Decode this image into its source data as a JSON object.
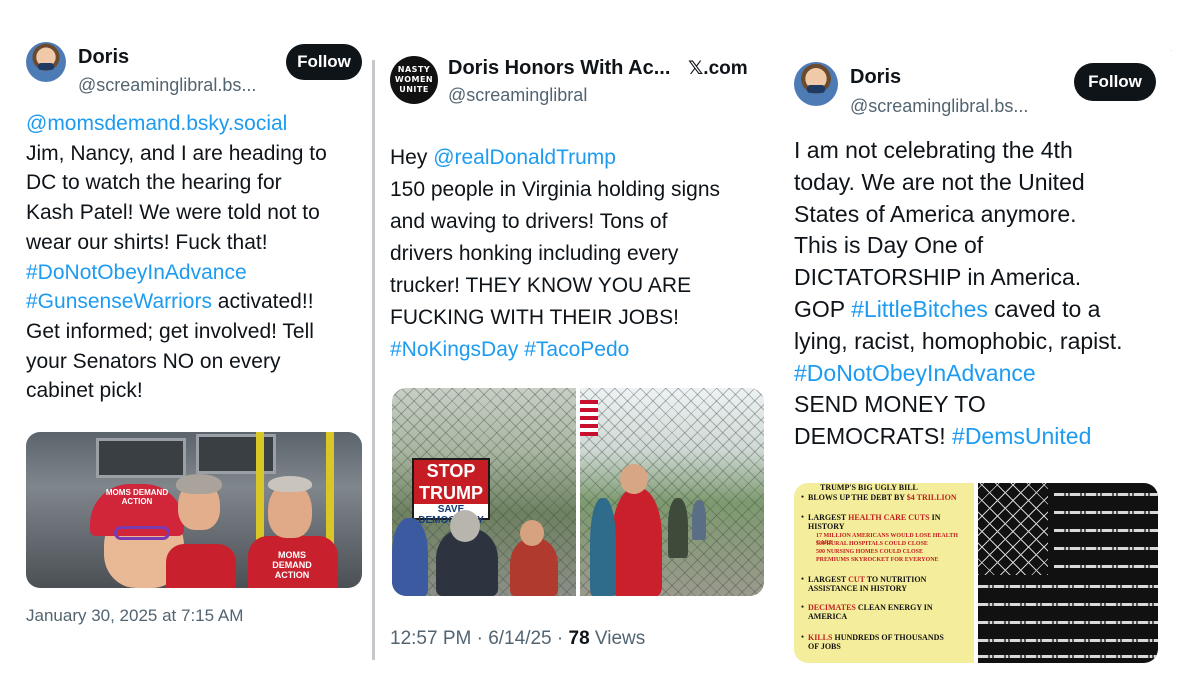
{
  "tweet1": {
    "name": "Doris",
    "handle": "@screaminglibral.bs...",
    "follow_label": "Follow",
    "lines": [
      {
        "text": "@momsdemand.bsky.social",
        "link": true
      },
      {
        "text": "Jim, Nancy, and I are heading to",
        "link": false
      },
      {
        "text": "DC to watch the hearing for",
        "link": false
      },
      {
        "text": "Kash Patel! We were told not to",
        "link": false
      },
      {
        "text": "wear our shirts! Fuck that!",
        "link": false
      },
      {
        "text": " #DoNotObeyInAdvance",
        "link": true
      }
    ],
    "line7_link": "#GunsenseWarriors",
    "line7_rest": " activated!!",
    "lines_after": [
      "Get informed; get involved! Tell",
      "your Senators NO on every",
      "cabinet pick!"
    ],
    "photo": {
      "hat_text": "MOMS DEMAND ACTION",
      "shirt_text": "MOMS DEMAND ACTION"
    },
    "timestamp": "January 30, 2025 at 7:15 AM"
  },
  "tweet2": {
    "name": "Doris Honors With Ac...",
    "handle": "@screaminglibral",
    "source": "𝕏.com",
    "avatar_lines": [
      "NASTY",
      "WOMEN",
      "UNITE"
    ],
    "hey": "Hey ",
    "mention": "@realDonaldTrump",
    "lines": [
      "150 people in Virginia holding signs",
      "and waving to drivers! Tons of",
      "drivers honking including every",
      "trucker! THEY KNOW YOU ARE",
      "FUCKING WITH THEIR JOBS!"
    ],
    "tag1": "#NoKingsDay",
    "tag2": "#TacoPedo",
    "sign": {
      "top": "STOP TRUMP",
      "bottom": "SAVE DEMOCRACY"
    },
    "time": "12:57 PM · 6/14/25 · ",
    "views_count": "78",
    "views_label": " Views"
  },
  "tweet3": {
    "name": "Doris",
    "handle": "@screaminglibral.bs...",
    "follow_label": "Follow",
    "lines_a": [
      "I am not celebrating the 4th",
      "today. We are not the United",
      "States of America anymore.",
      "This is Day One of",
      "DICTATORSHIP in America."
    ],
    "gop_pre": "GOP ",
    "gop_tag": "#LittleBitches",
    "gop_post": " caved to a",
    "line_racist": "lying, racist, homophobic, rapist.",
    "tag_obey": "#DoNotObeyInAdvance",
    "line_send": "SEND MONEY TO",
    "dem_pre": "DEMOCRATS! ",
    "dem_tag": "#DemsUnited",
    "bill": {
      "title": "TRUMP'S BIG UGLY BILL",
      "items": [
        {
          "pre": "BLOWS UP THE DEBT BY ",
          "red": "$4 TRILLION",
          "post": ""
        },
        {
          "pre": "LARGEST ",
          "red": "HEALTH CARE CUTS",
          "post": " IN HISTORY"
        },
        {
          "pre": "LARGEST ",
          "red": "CUT",
          "post": " TO NUTRITION ASSISTANCE IN HISTORY"
        },
        {
          "pre": "",
          "red": "DECIMATES",
          "post": " CLEAN ENERGY IN AMERICA"
        },
        {
          "pre": "",
          "red": "KILLS",
          "post": " HUNDREDS OF THOUSANDS OF JOBS"
        }
      ],
      "subs": [
        "17 MILLION AMERICANS WOULD LOSE HEALTH CARE",
        "300 RURAL HOSPITALS COULD CLOSE",
        "500 NURSING HOMES COULD CLOSE",
        "PREMIUMS SKYROCKET FOR EVERYONE"
      ]
    }
  }
}
